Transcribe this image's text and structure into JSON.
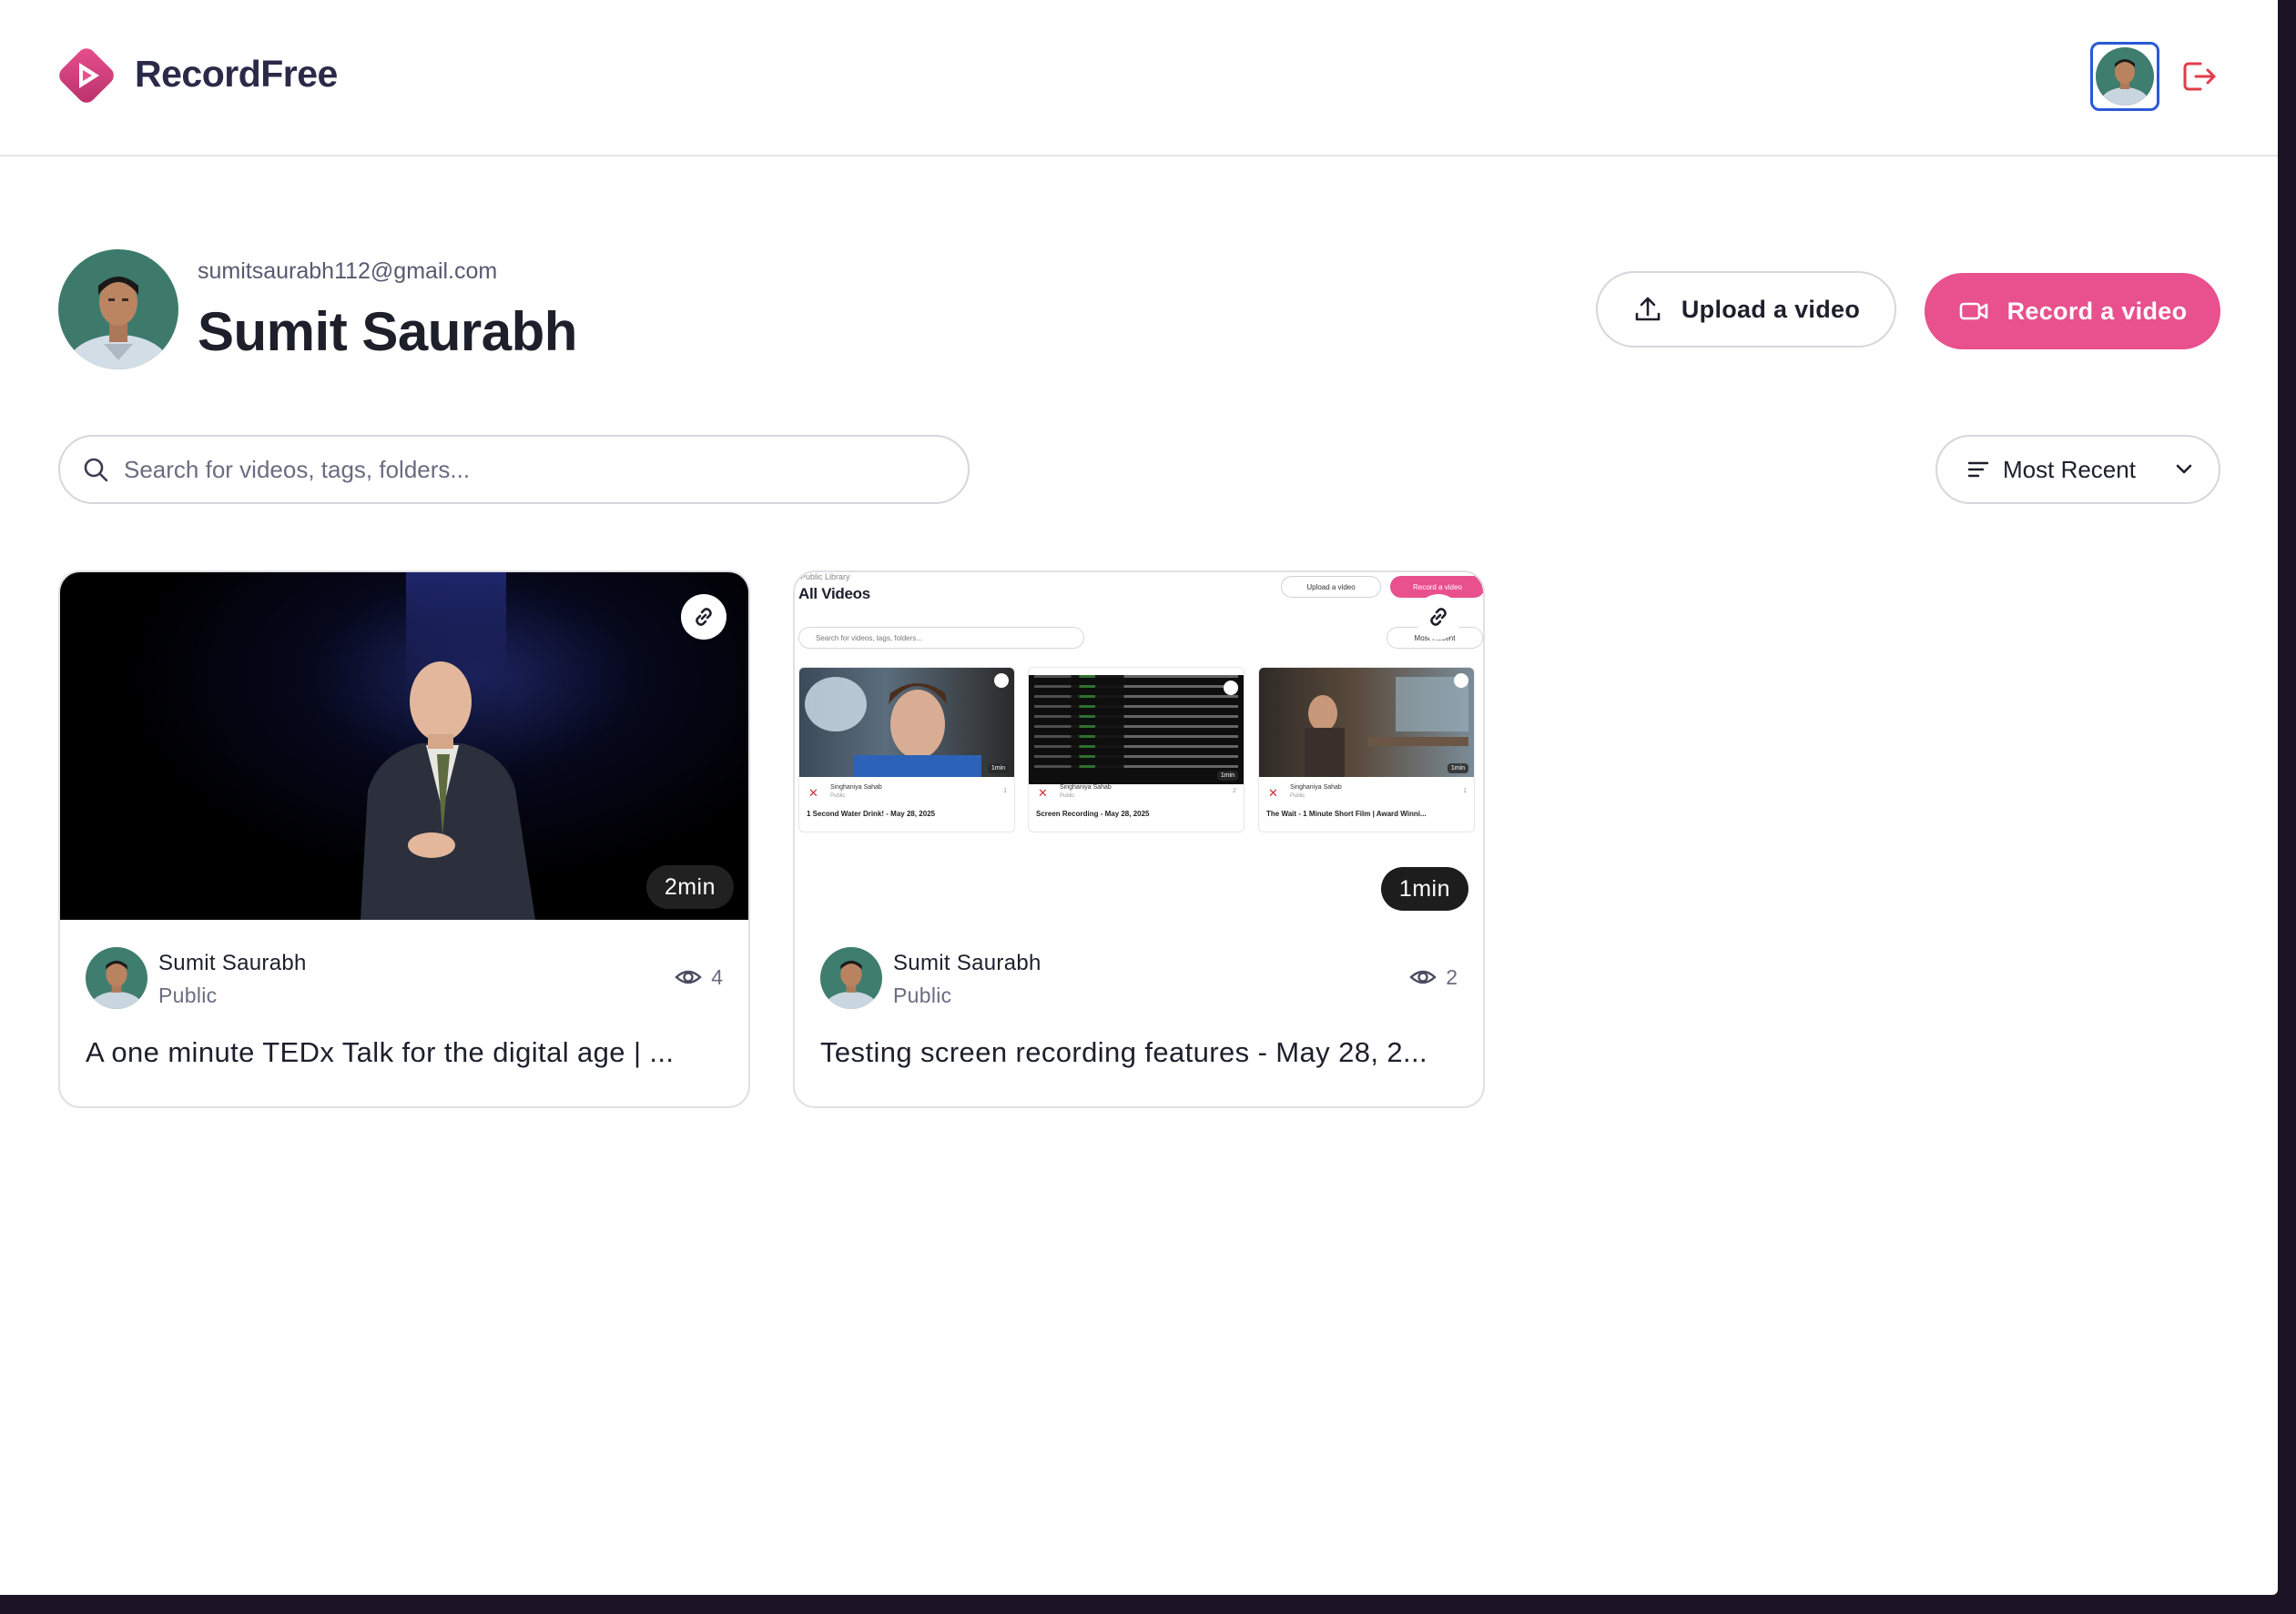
{
  "app": {
    "brand": "RecordFree",
    "accent_color": "#e8508e",
    "logout_icon": "logout-icon"
  },
  "profile": {
    "email": "sumitsaurabh112@gmail.com",
    "name": "Sumit Saurabh"
  },
  "actions": {
    "upload_label": "Upload a video",
    "record_label": "Record a video"
  },
  "search": {
    "placeholder": "Search for videos, tags, folders...",
    "value": ""
  },
  "sort": {
    "selected": "Most Recent"
  },
  "videos": [
    {
      "duration": "2min",
      "author": "Sumit Saurabh",
      "visibility": "Public",
      "views": "4",
      "title": "A one minute TEDx Talk for the digital age | ..."
    },
    {
      "duration": "1min",
      "author": "Sumit Saurabh",
      "visibility": "Public",
      "views": "2",
      "title": "Testing screen recording features - May 28, 2..."
    }
  ],
  "thumbnail_preview": {
    "library_label": "Public Library",
    "title": "All Videos",
    "upload_label": "Upload a video",
    "record_label": "Record a video",
    "search_placeholder": "Search for videos, tags, folders...",
    "sort_label": "Most Recent",
    "cards": [
      {
        "author": "Singhaniya Sahab",
        "visibility": "Public",
        "views": "1",
        "duration": "1min",
        "title": "1 Second Water Drink! - May 28, 2025"
      },
      {
        "author": "Singhaniya Sahab",
        "visibility": "Public",
        "views": "2",
        "duration": "1min",
        "title": "Screen Recording - May 28, 2025"
      },
      {
        "author": "Singhaniya Sahab",
        "visibility": "Public",
        "views": "1",
        "duration": "1min",
        "title": "The Wait - 1 Minute Short Film | Award Winni..."
      }
    ]
  }
}
